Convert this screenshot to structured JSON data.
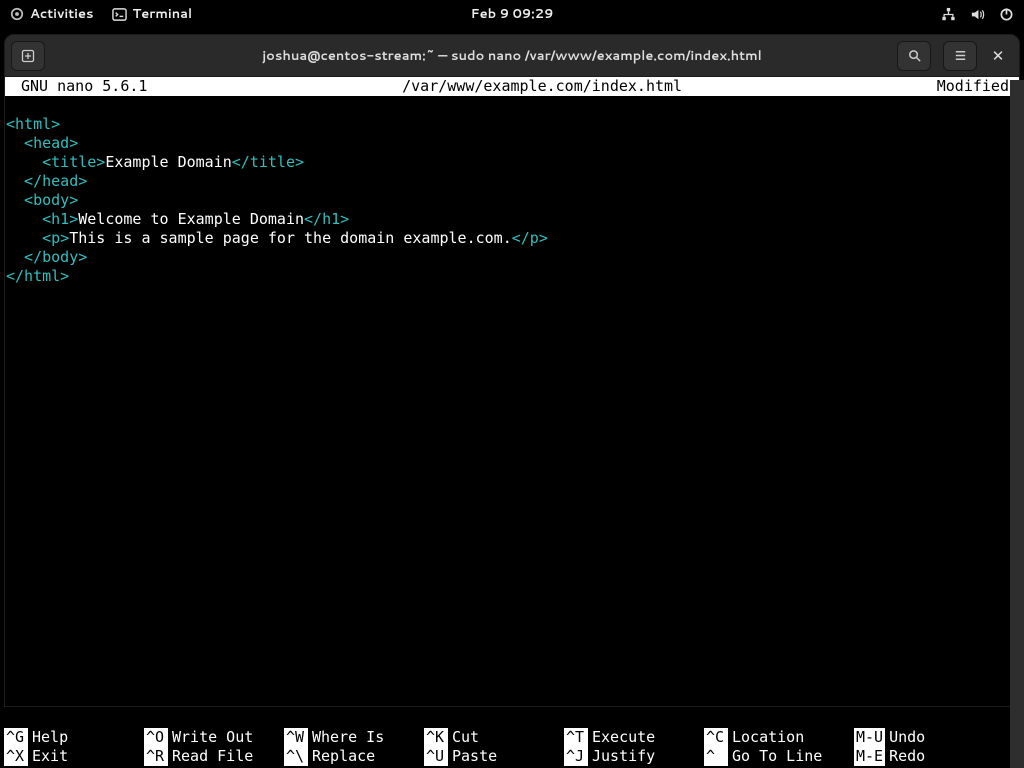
{
  "topbar": {
    "activities": "Activities",
    "terminal": "Terminal",
    "clock": "Feb 9  09:29"
  },
  "window": {
    "title": "joshua@centos-stream:~ — sudo nano /var/www/example.com/index.html"
  },
  "nano": {
    "version": "GNU nano 5.6.1",
    "filepath": "/var/www/example.com/index.html",
    "status": "Modified"
  },
  "content": {
    "l1a": "<html>",
    "l2a": "  <head>",
    "l3a": "    <title>",
    "l3b": "Example Domain",
    "l3c": "</title>",
    "l4a": "  </head>",
    "l5a": "  <body>",
    "l6a": "    <h1>",
    "l6b": "Welcome to Example Domain",
    "l6c": "</h1>",
    "l7a": "    <p>",
    "l7b": "This is a sample page for the domain example.com.",
    "l7c": "</p>",
    "l8a": "  </body>",
    "l9a": "</html>"
  },
  "shortcuts": {
    "row1": [
      {
        "k": "^G",
        "l": "Help"
      },
      {
        "k": "^O",
        "l": "Write Out"
      },
      {
        "k": "^W",
        "l": "Where Is"
      },
      {
        "k": "^K",
        "l": "Cut"
      },
      {
        "k": "^T",
        "l": "Execute"
      },
      {
        "k": "^C",
        "l": "Location"
      },
      {
        "k": "M-U",
        "l": "Undo"
      }
    ],
    "row2": [
      {
        "k": "^X",
        "l": "Exit"
      },
      {
        "k": "^R",
        "l": "Read File"
      },
      {
        "k": "^\\",
        "l": "Replace"
      },
      {
        "k": "^U",
        "l": "Paste"
      },
      {
        "k": "^J",
        "l": "Justify"
      },
      {
        "k": "^ ",
        "l": "Go To Line"
      },
      {
        "k": "M-E",
        "l": "Redo"
      }
    ]
  }
}
